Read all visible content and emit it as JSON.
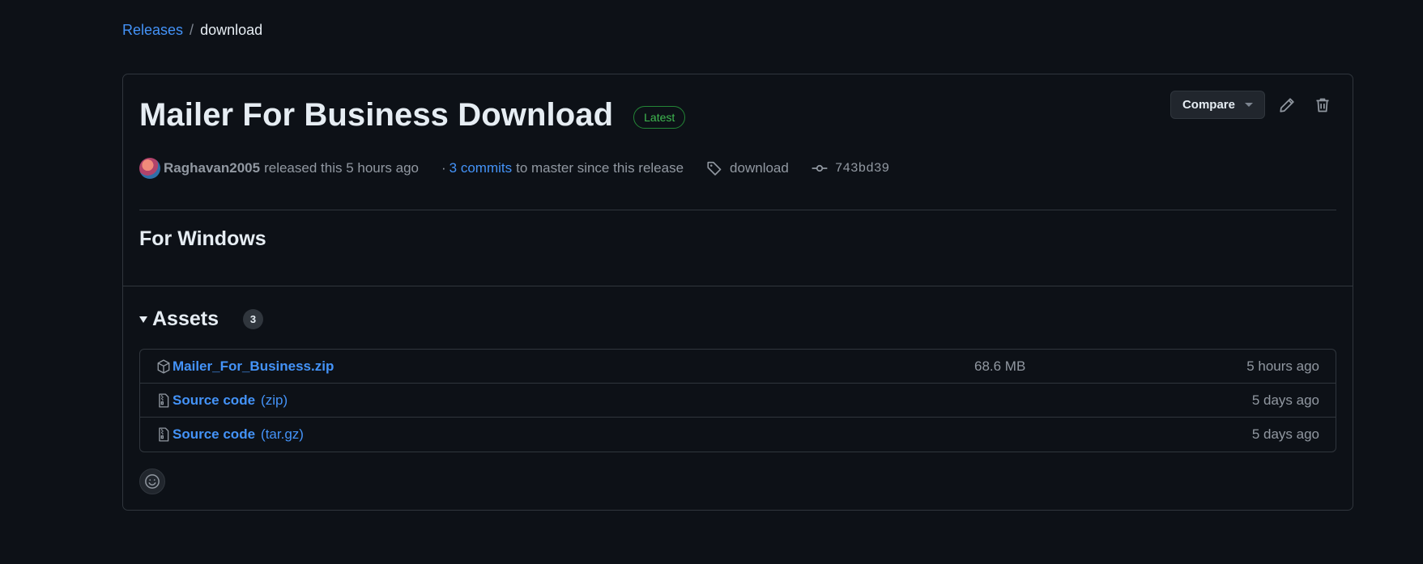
{
  "breadcrumb": {
    "releases_label": "Releases",
    "separator": "/",
    "current": "download"
  },
  "release": {
    "title": "Mailer For Business Download",
    "badge": "Latest",
    "compare_label": "Compare",
    "author": "Raghavan2005",
    "released_text": "released this 5 hours ago",
    "dot": "·",
    "commits_link": "3 commits",
    "commits_rest": "to master since this release",
    "tag": "download",
    "commit_sha": "743bd39",
    "body_heading": "For Windows"
  },
  "assets": {
    "title": "Assets",
    "count": "3",
    "items": [
      {
        "icon": "package-icon",
        "name": "Mailer_For_Business.zip",
        "sub": "",
        "size": "68.6 MB",
        "time": "5 hours ago"
      },
      {
        "icon": "file-zip-icon",
        "name": "Source code",
        "sub": "(zip)",
        "size": "",
        "time": "5 days ago"
      },
      {
        "icon": "file-zip-icon",
        "name": "Source code",
        "sub": "(tar.gz)",
        "size": "",
        "time": "5 days ago"
      }
    ]
  },
  "colors": {
    "background": "#0d1117",
    "link": "#4493f8",
    "latest_badge": "#3fb950",
    "border": "#30363d",
    "muted_text": "#9198a1"
  }
}
